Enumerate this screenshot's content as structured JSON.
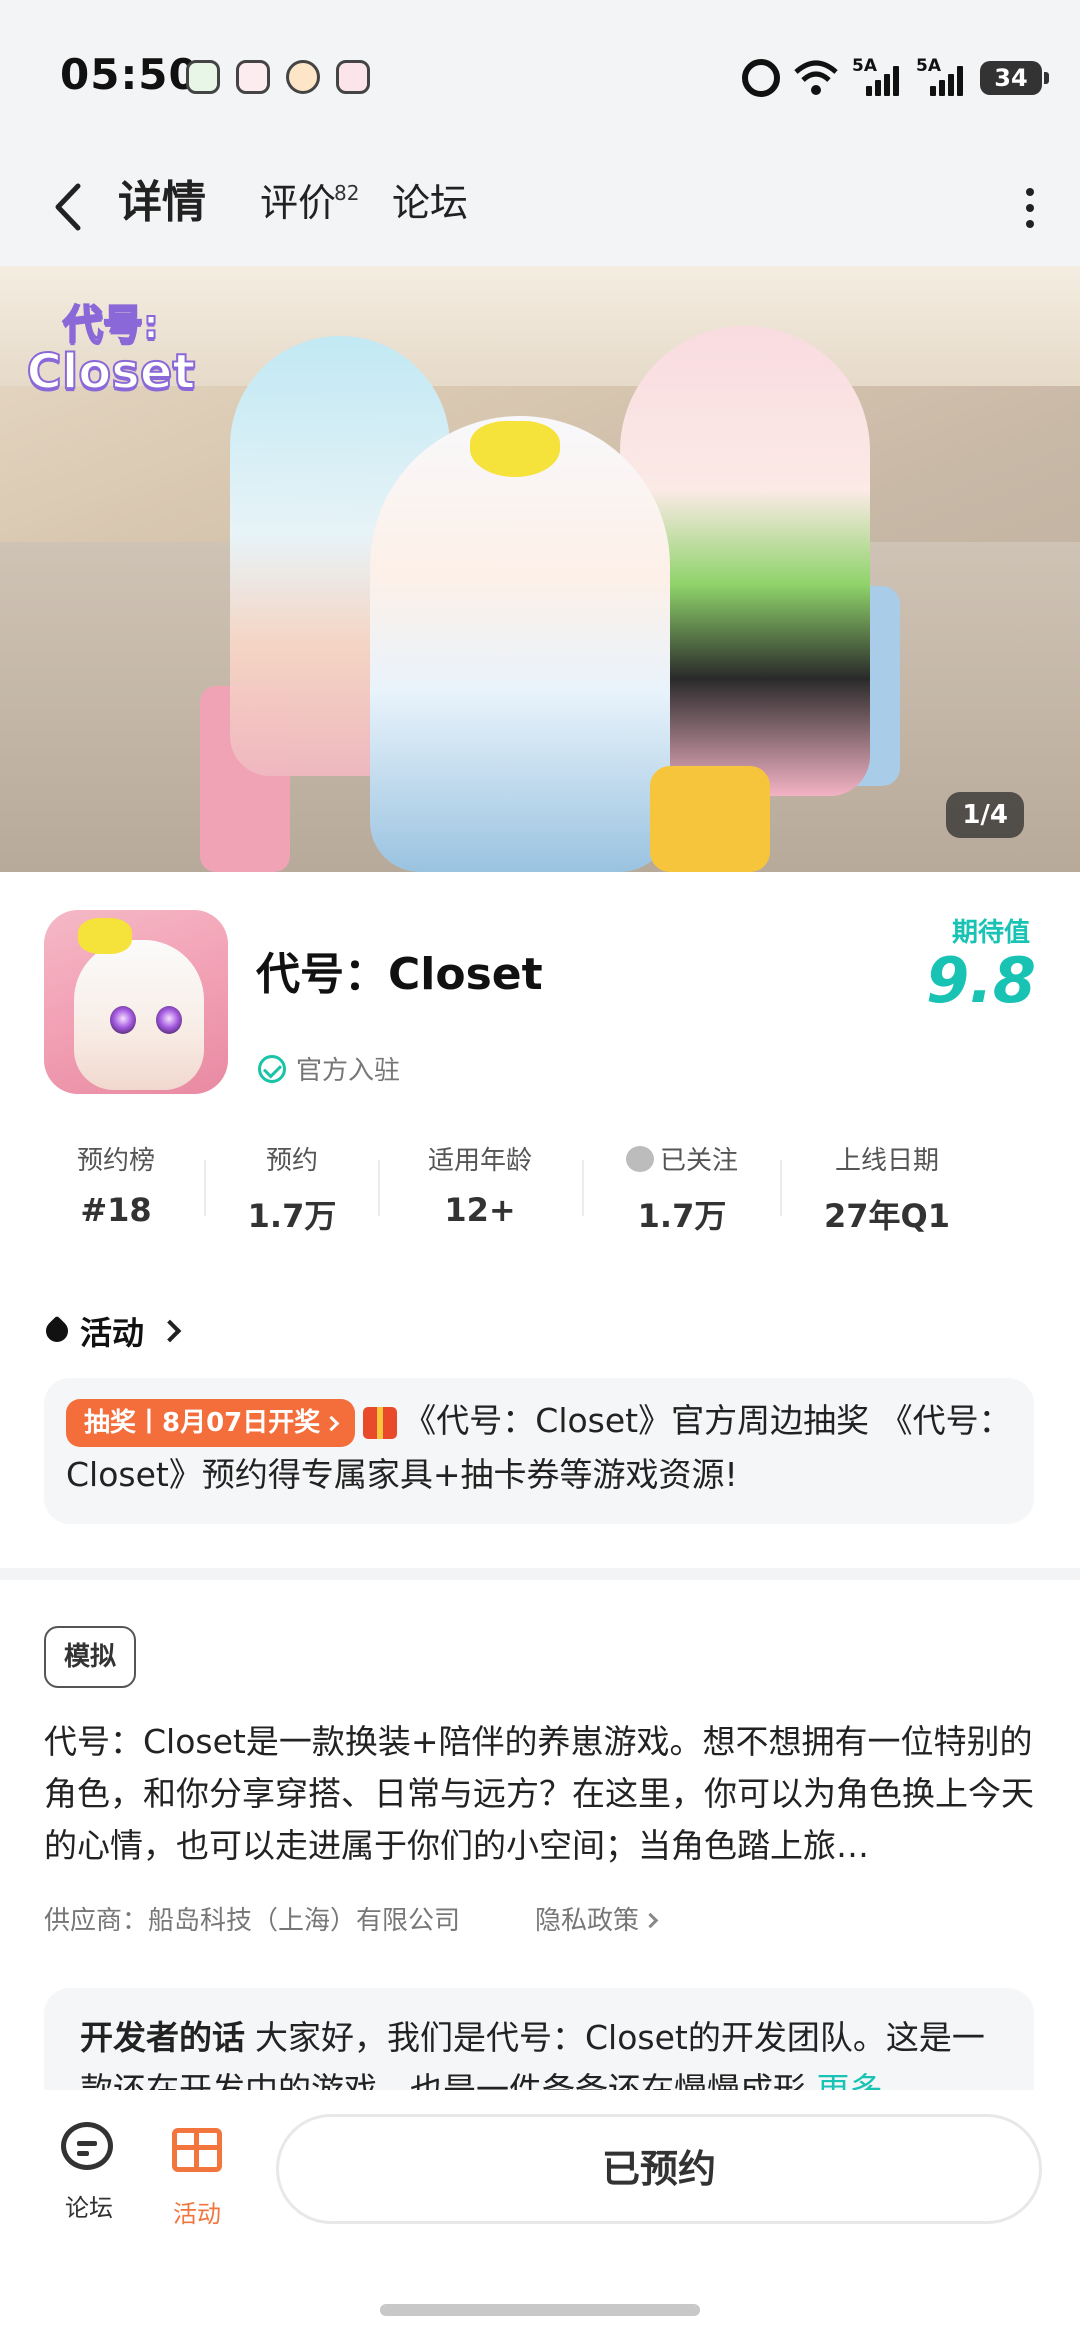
{
  "status_bar": {
    "time": "05:50",
    "network_1": "5A",
    "network_2": "5A",
    "battery": "34"
  },
  "nav": {
    "tabs": [
      {
        "label": "详情",
        "active": true
      },
      {
        "label": "评价",
        "badge": "82"
      },
      {
        "label": "论坛"
      }
    ]
  },
  "hero": {
    "logo_line1": "代号:",
    "logo_line2": "Closet",
    "counter": "1/4"
  },
  "app": {
    "title": "代号：Closet",
    "official_label": "官方入驻",
    "expect_label": "期待值",
    "expect_value": "9.8"
  },
  "stats": [
    {
      "label": "预约榜",
      "value": "#18"
    },
    {
      "label": "预约",
      "value": "1.7万"
    },
    {
      "label": "适用年龄",
      "value": "12+"
    },
    {
      "label": "已关注",
      "value": "1.7万"
    },
    {
      "label": "上线日期",
      "value": "27年Q1"
    }
  ],
  "activity": {
    "section_title": "活动",
    "tag": "抽奖丨8月07日开奖",
    "text": "《代号：Closet》官方周边抽奖 《代号：Closet》预约得专属家具+抽卡券等游戏资源!"
  },
  "description": {
    "genre_tag": "模拟",
    "text": "代号：Closet是一款换装+陪伴的养崽游戏。想不想拥有一位特别的角色，和你分享穿搭、日常与远方？在这里，你可以为角色换上今天的心情，也可以走进属于你们的小空间；当角色踏上旅…",
    "supplier": "供应商：船岛科技（上海）有限公司",
    "privacy": "隐私政策"
  },
  "developer": {
    "heading": "开发者的话",
    "text": "大家好，我们是代号：Closet的开发团队。这是一款还在开发中的游戏，也是一件备备还在慢慢成形",
    "more": "更多"
  },
  "bottom_bar": {
    "forum_label": "论坛",
    "activity_label": "活动",
    "reserve_button": "已预约"
  },
  "colors": {
    "accent": "#18c3b4",
    "activity_tag": "#f46e3c",
    "activity_icon": "#f1753c"
  }
}
